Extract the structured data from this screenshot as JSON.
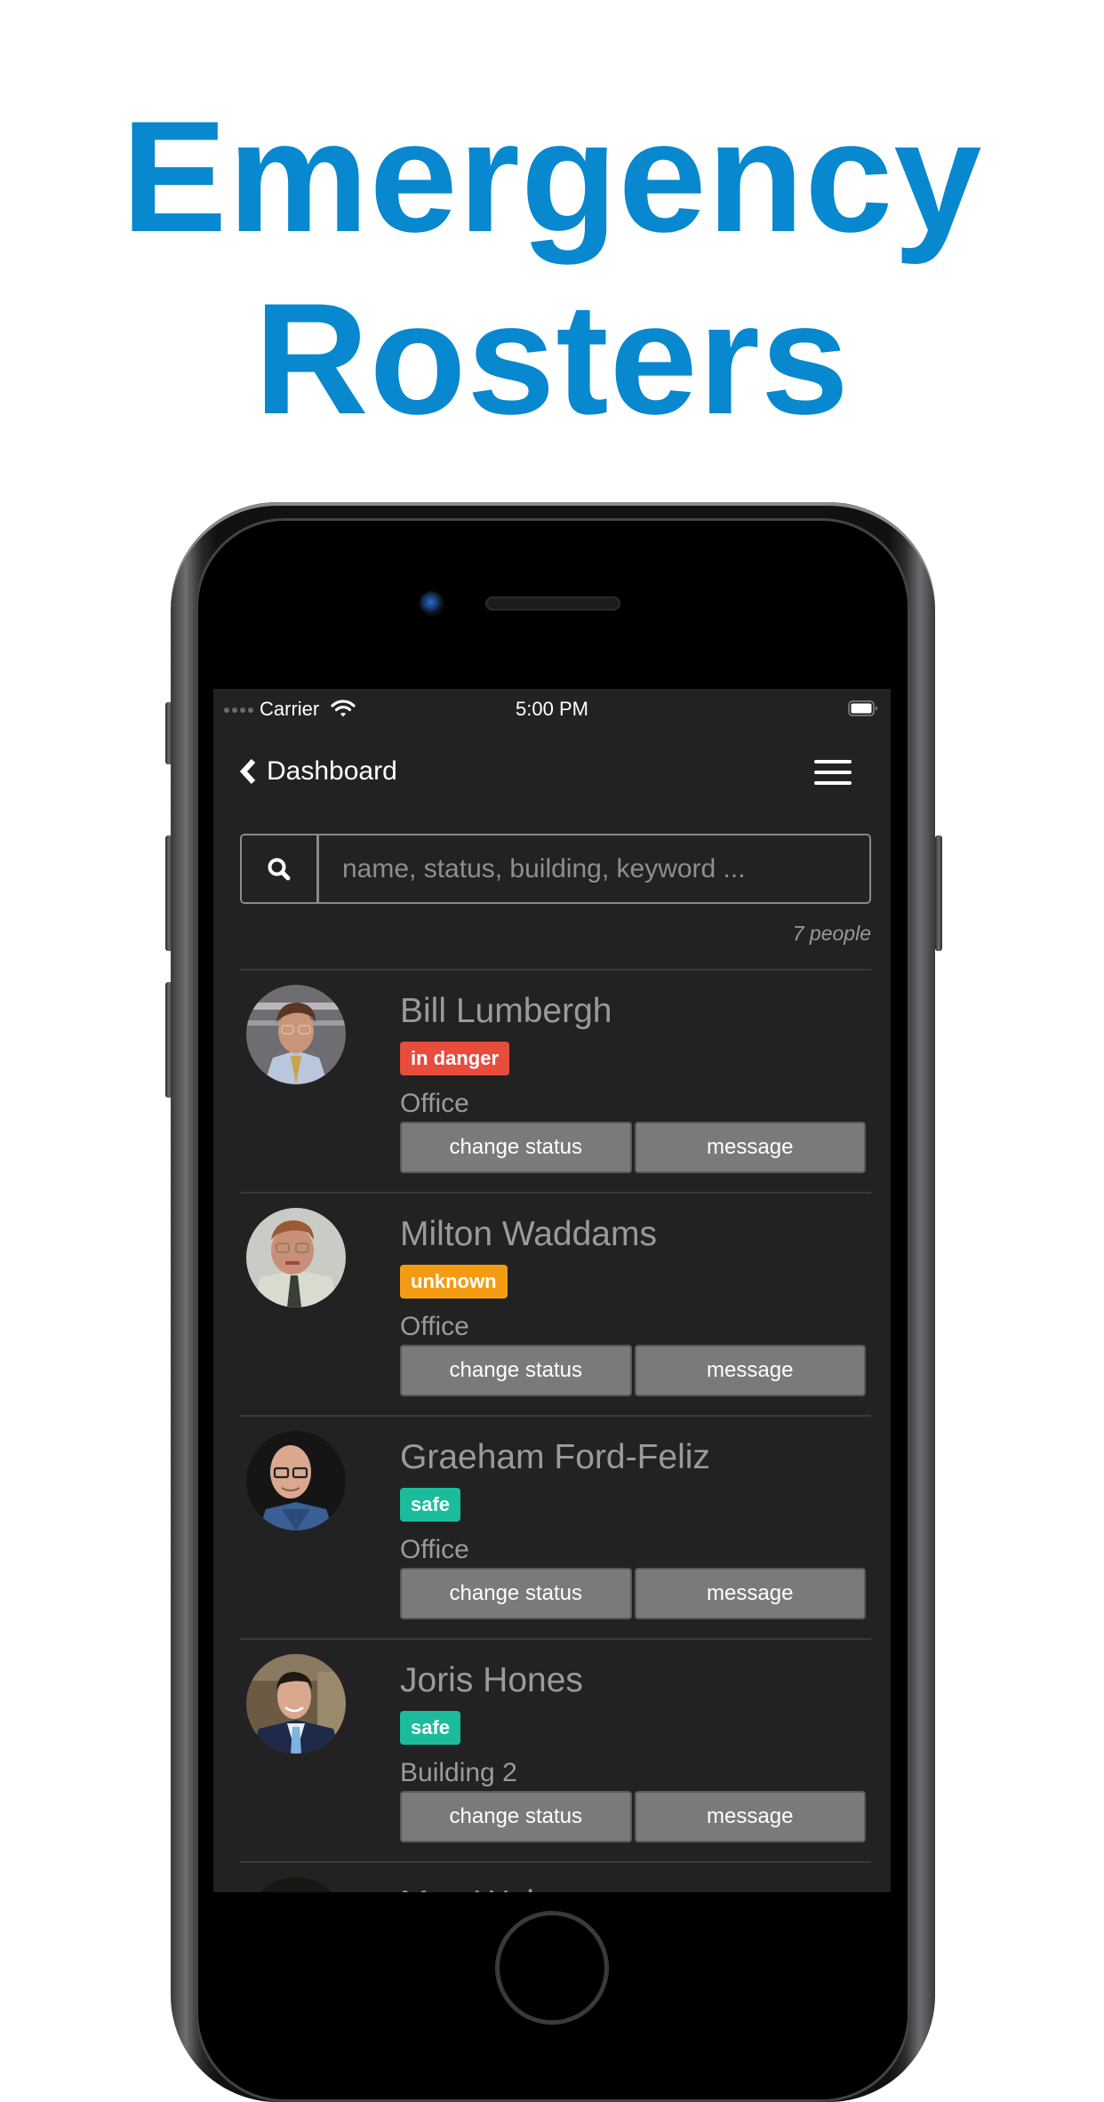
{
  "headline": {
    "line1": "Emergency",
    "line2": "Rosters"
  },
  "colors": {
    "headline": "#0888CF",
    "in_danger": "#E74C3C",
    "unknown": "#F39C12",
    "safe": "#1ABC9C"
  },
  "statusbar": {
    "carrier": "Carrier",
    "time": "5:00 PM",
    "signal_icon": "signal-dots-icon",
    "wifi_icon": "wifi-icon",
    "battery_icon": "battery-icon"
  },
  "navbar": {
    "back_label": "Dashboard",
    "back_icon": "chevron-left-icon",
    "menu_icon": "hamburger-menu-icon"
  },
  "search": {
    "placeholder": "name, status, building, keyword ...",
    "value": "",
    "icon": "search-icon"
  },
  "count_label": "7 people",
  "people": [
    {
      "name": "Bill Lumbergh",
      "status": "in danger",
      "status_key": "in_danger",
      "building": "Office",
      "actions": [
        "change status",
        "message"
      ]
    },
    {
      "name": "Milton Waddams",
      "status": "unknown",
      "status_key": "unknown",
      "building": "Office",
      "actions": [
        "change status",
        "message"
      ]
    },
    {
      "name": "Graeham Ford-Feliz",
      "status": "safe",
      "status_key": "safe",
      "building": "Office",
      "actions": [
        "change status",
        "message"
      ]
    },
    {
      "name": "Joris Hones",
      "status": "safe",
      "status_key": "safe",
      "building": "Building 2",
      "actions": [
        "change status",
        "message"
      ]
    },
    {
      "name": "Max Weber"
    }
  ]
}
